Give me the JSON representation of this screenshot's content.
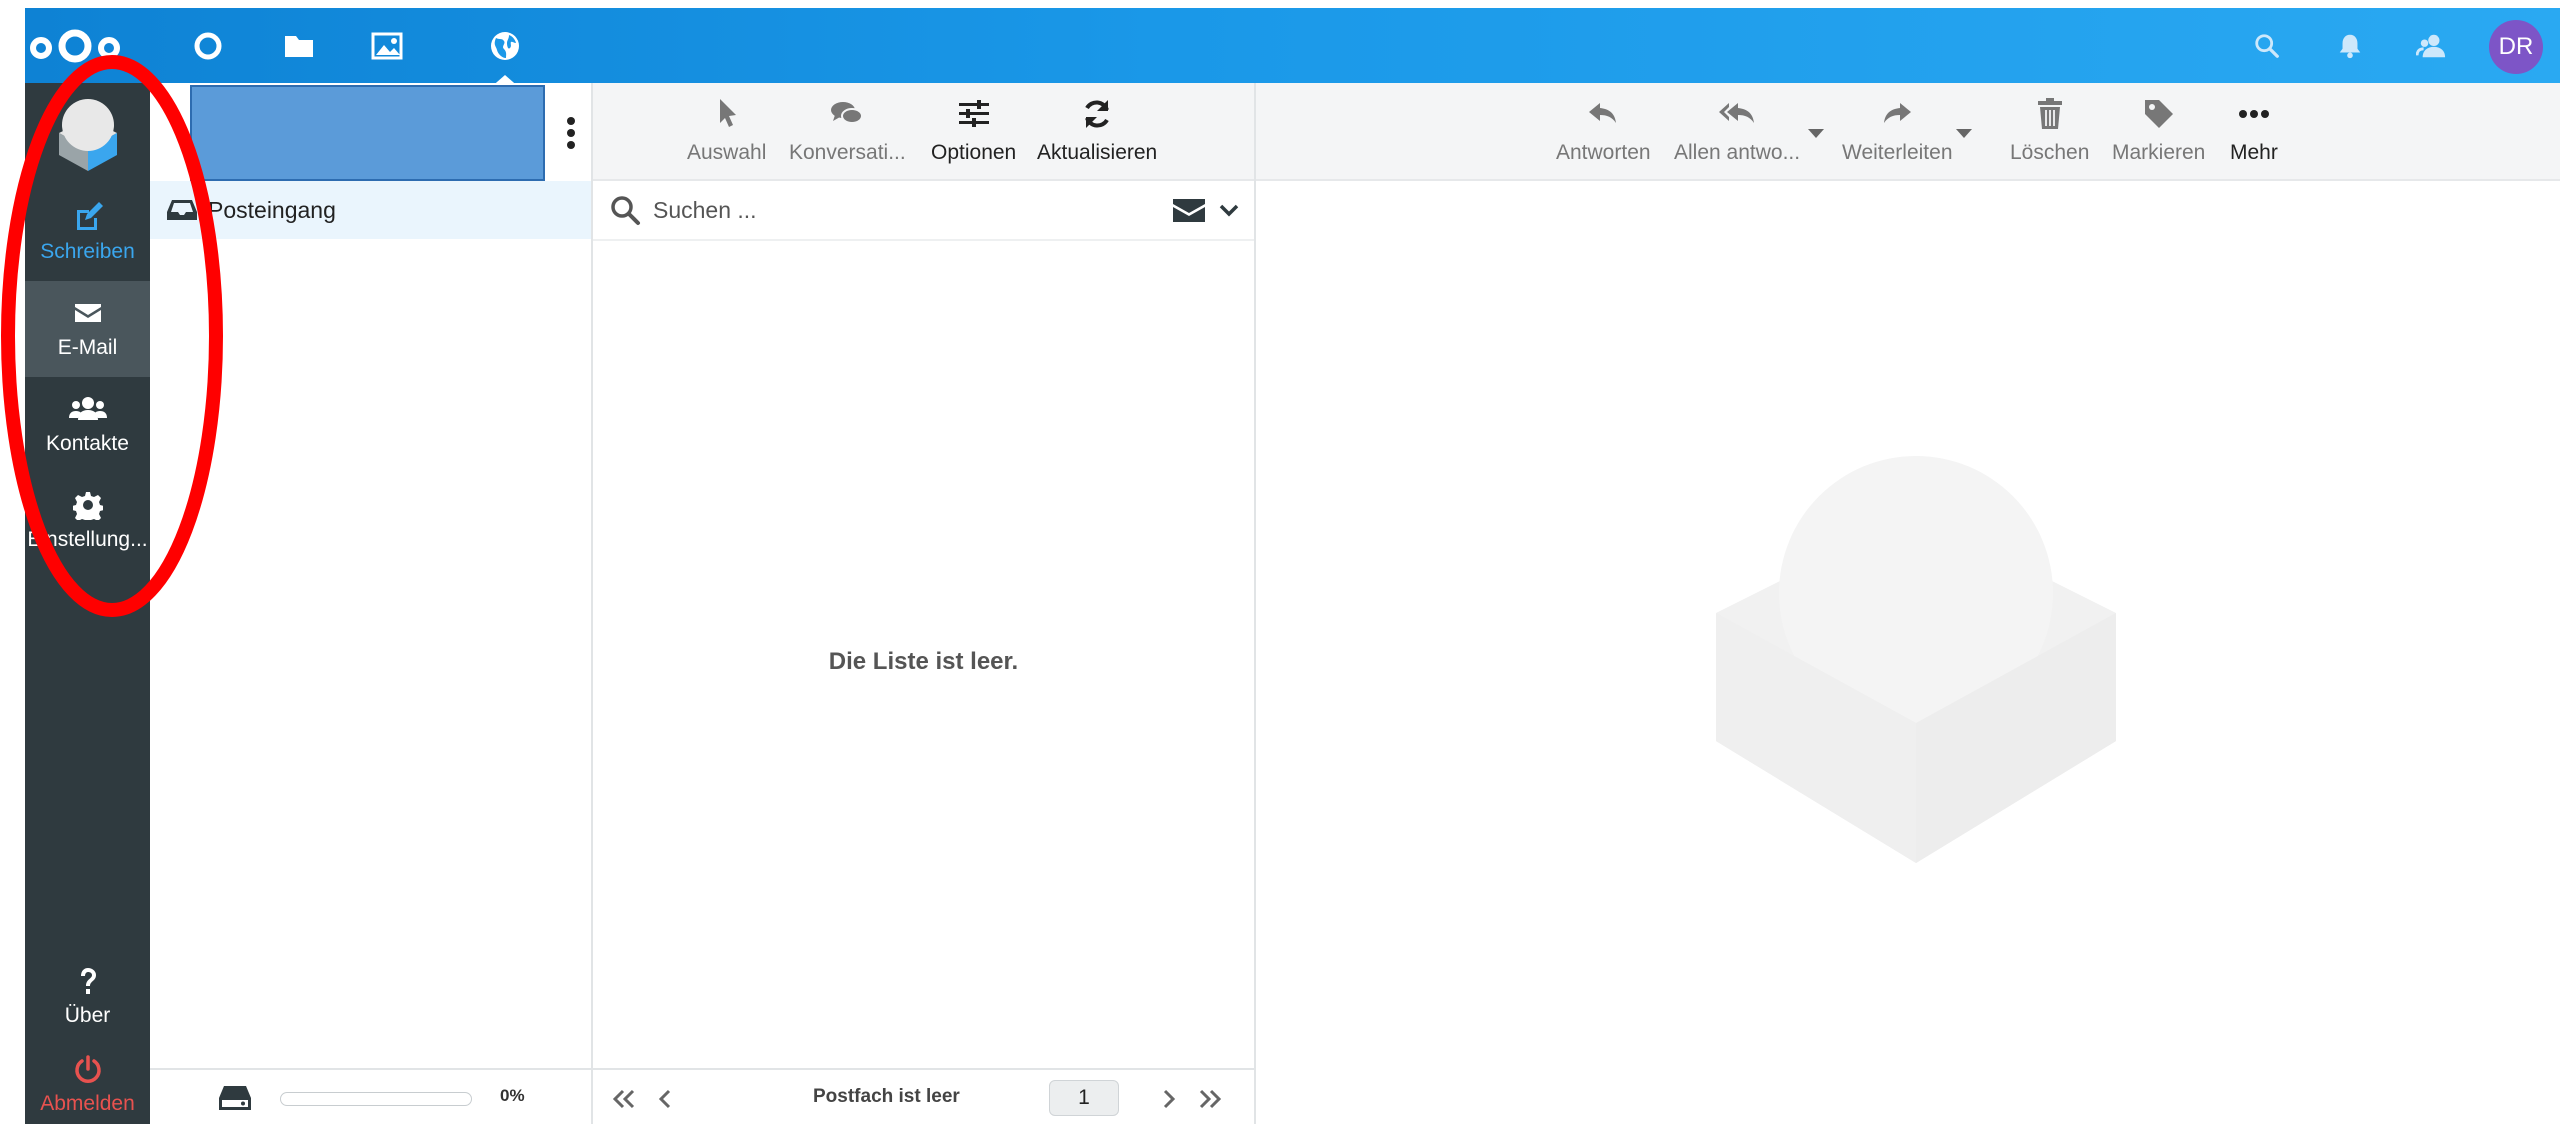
{
  "app": {
    "top_apps": [
      "dashboard-icon",
      "files-icon",
      "photos-icon",
      "mail-icon"
    ],
    "top_right": [
      "search-icon",
      "bell-icon",
      "contacts-icon"
    ],
    "avatar_initials": "DR",
    "colors": {
      "topbar": "#1a98e8",
      "rail": "#2f3a3f",
      "accent": "#3aa6ee",
      "logout": "#e8524f",
      "avatar": "#7d55c7",
      "annotation": "#ff0000"
    }
  },
  "rail": {
    "compose": "Schreiben",
    "mail": "E-Mail",
    "contacts": "Kontakte",
    "settings": "Einstellung...",
    "about": "Über",
    "logout": "Abmelden"
  },
  "folders": {
    "items": [
      {
        "label": "Posteingang",
        "icon": "inbox-icon"
      }
    ],
    "quota_percent": "0%",
    "quota_used_fraction": 0
  },
  "list": {
    "toolbar": {
      "select": "Auswahl",
      "threads": "Konversati...",
      "options": "Optionen",
      "refresh": "Aktualisieren"
    },
    "search_placeholder": "Suchen ...",
    "empty_message": "Die Liste ist leer.",
    "pager_status": "Postfach ist leer",
    "page": "1"
  },
  "view": {
    "toolbar": {
      "reply": "Antworten",
      "reply_all": "Allen antwo...",
      "forward": "Weiterleiten",
      "delete": "Löschen",
      "mark": "Markieren",
      "more": "Mehr"
    }
  }
}
